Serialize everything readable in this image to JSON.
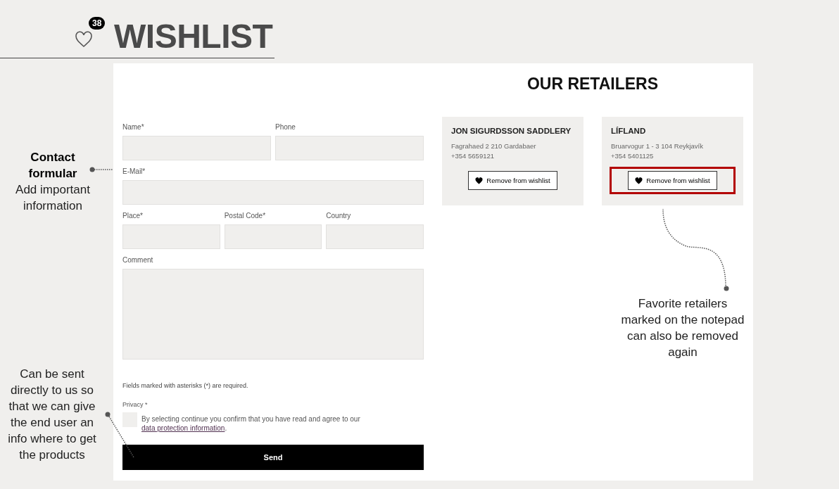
{
  "header": {
    "title": "WISHLIST",
    "badge": "38"
  },
  "form": {
    "rows": [
      [
        {
          "label": "Name*",
          "kind": "input"
        },
        {
          "label": "Phone",
          "kind": "input"
        }
      ],
      [
        {
          "label": "E-Mail*",
          "kind": "input"
        }
      ],
      [
        {
          "label": "Place*",
          "kind": "input"
        },
        {
          "label": "Postal Code*",
          "kind": "input"
        },
        {
          "label": "Country",
          "kind": "input"
        }
      ],
      [
        {
          "label": "Comment",
          "kind": "textarea"
        }
      ]
    ],
    "note": "Fields marked with asterisks (*) are required.",
    "privacy": {
      "label": "Privacy *",
      "checked": false,
      "text": "By selecting continue you confirm that you have read and agree to our",
      "link": "data protection information",
      "after": "."
    },
    "submit": "Send"
  },
  "retailers": {
    "title": "OUR RETAILERS",
    "items": [
      {
        "name": "JON SIGURDSSON SADDLERY",
        "address": "Fagrahaed 2 210 Gardabaer",
        "phone": "+354 5659121",
        "button": "Remove from wishlist",
        "highlighted": false
      },
      {
        "name": "LÍFLAND",
        "address": "Bruarvogur 1 - 3 104 Reykjavík",
        "phone": "+354 5401125",
        "button": "Remove from wishlist",
        "highlighted": true
      }
    ]
  },
  "annotations": [
    {
      "title": "Contact formular",
      "text": "Add important information"
    },
    {
      "text": "Can be sent directly to us so that we can give the end user an info where to get the products"
    },
    {
      "text": "Favorite retailers marked on the notepad can also be removed again"
    }
  ]
}
